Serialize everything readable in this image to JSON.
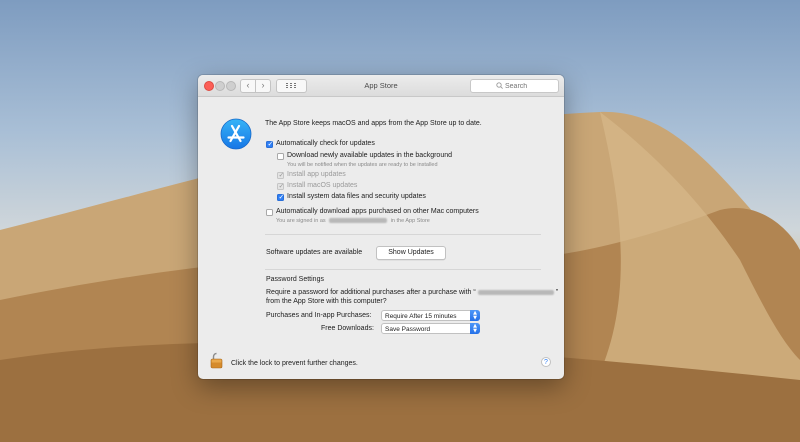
{
  "window": {
    "title": "App Store",
    "nav_back": "‹",
    "nav_forward": "›",
    "search_placeholder": "Search"
  },
  "intro": "The App Store keeps macOS and apps from the App Store up to date.",
  "options": {
    "auto_check": {
      "label": "Automatically check for updates",
      "checked": true
    },
    "download_bg": {
      "label": "Download newly available updates in the background",
      "checked": false,
      "note": "You will be notified when the updates are ready to be installed"
    },
    "install_app": {
      "label": "Install app updates",
      "checked": true,
      "enabled": false
    },
    "install_macos": {
      "label": "Install macOS updates",
      "checked": true,
      "enabled": false
    },
    "install_system": {
      "label": "Install system data files and security updates",
      "checked": true
    },
    "auto_download": {
      "label": "Automatically download apps purchased on other Mac computers",
      "checked": false,
      "note_prefix": "You are signed in as",
      "note_suffix": "in the App Store"
    }
  },
  "software_updates": {
    "text": "Software updates are available",
    "button": "Show Updates"
  },
  "password": {
    "heading": "Password Settings",
    "desc_line1": "Require a password for additional purchases after a purchase with “",
    "desc_line1_end": "”",
    "desc_line2": "from the App Store with this computer?",
    "purchases_label": "Purchases and In-app Purchases:",
    "purchases_value": "Require After 15 minutes",
    "free_label": "Free Downloads:",
    "free_value": "Save Password"
  },
  "lock_text": "Click the lock to prevent further changes.",
  "help": "?",
  "colors": {
    "accent": "#2f7ff5",
    "close": "#fc5f57"
  }
}
